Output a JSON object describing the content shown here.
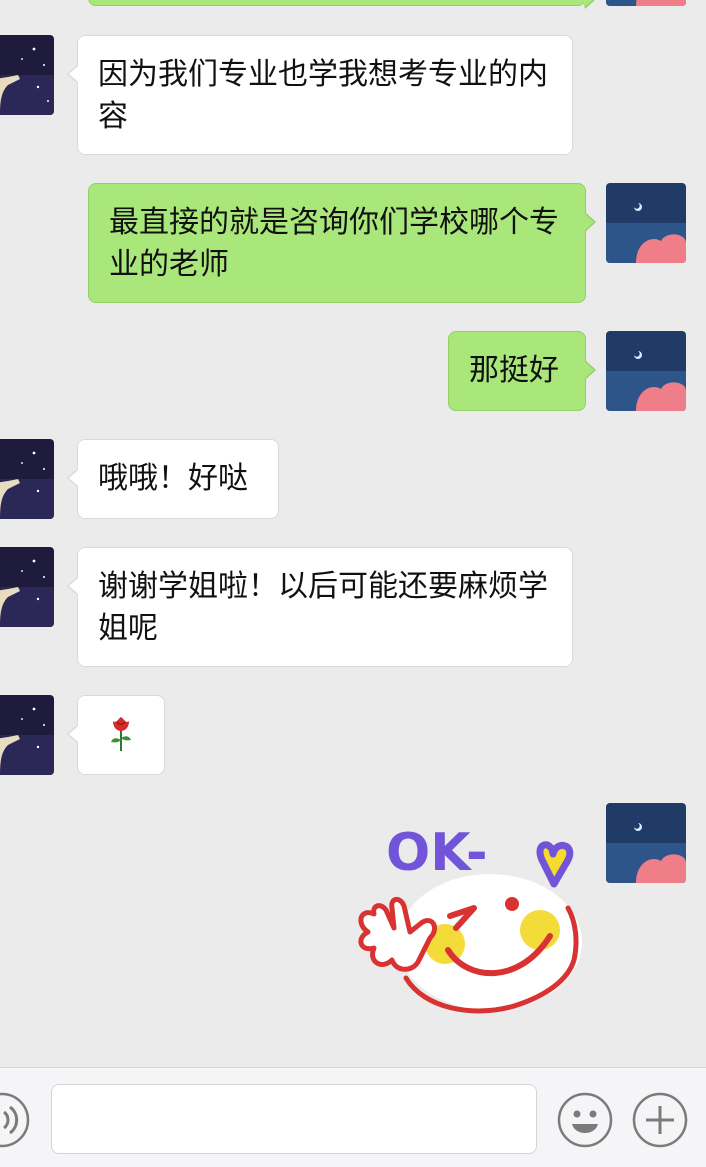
{
  "messages": [
    {
      "from": "other",
      "text": "因为我们专业也学我想考专业的内容"
    },
    {
      "from": "me",
      "text": "最直接的就是咨询你们学校哪个专业的老师"
    },
    {
      "from": "me",
      "text": "那挺好"
    },
    {
      "from": "other",
      "text": "哦哦！好哒"
    },
    {
      "from": "other",
      "text": "谢谢学姐啦！以后可能还要麻烦学姐呢"
    },
    {
      "from": "other",
      "content": "rose-emoji"
    },
    {
      "from": "me",
      "content": "ok-sticker",
      "sticker_text": "OK-"
    }
  ],
  "colors": {
    "background": "#ebebeb",
    "outgoing_bubble": "#a9e77a",
    "incoming_bubble": "#ffffff",
    "input_bar": "#f5f5f7"
  },
  "input_bar": {
    "text_value": "",
    "icons": [
      "voice-icon",
      "emoji-icon",
      "plus-icon"
    ]
  }
}
